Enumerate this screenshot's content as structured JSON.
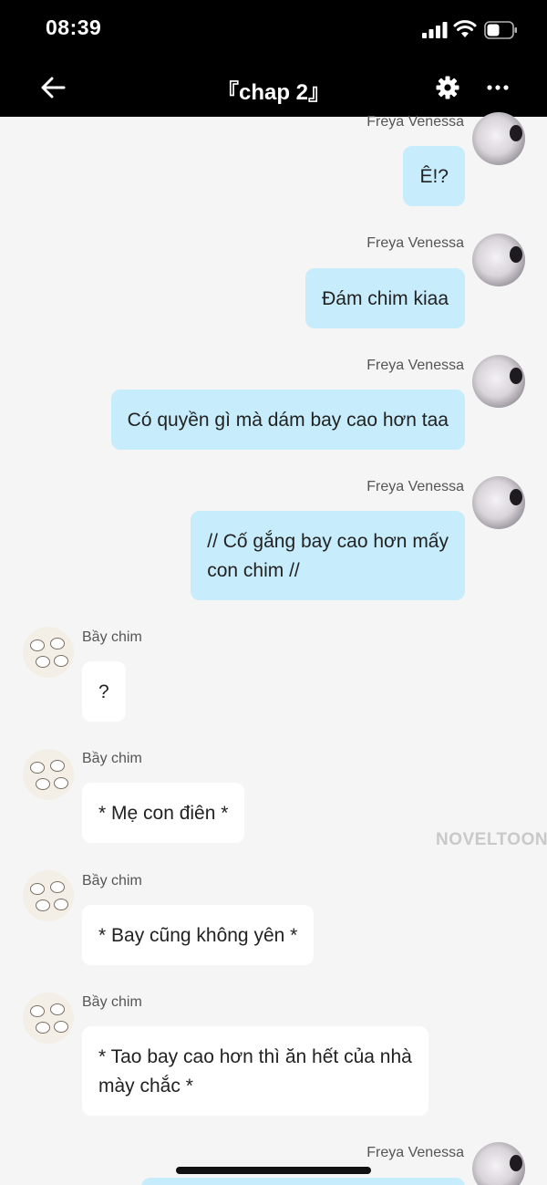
{
  "status": {
    "time": "08:39"
  },
  "header": {
    "title": "『chap 2』"
  },
  "watermark": "NOVELTOON",
  "messages": [
    {
      "sender": "Freya Venessa",
      "text": "Ê!?"
    },
    {
      "sender": "Freya Venessa",
      "text": "Đám chim kiaa"
    },
    {
      "sender": "Freya Venessa",
      "text": "Có quyền gì mà dám bay cao hơn taa"
    },
    {
      "sender": "Freya Venessa",
      "line1": "// Cố gắng bay cao hơn mấy",
      "line2": "con chim //"
    },
    {
      "sender": "Bầy chim",
      "text": "?"
    },
    {
      "sender": "Bầy chim",
      "text": "* Mẹ con điên *"
    },
    {
      "sender": "Bầy chim",
      "text": "* Bay cũng không yên *"
    },
    {
      "sender": "Bầy chim",
      "line1": "* Tao bay cao hơn thì ăn hết của nhà",
      "line2": "mày chắc *"
    },
    {
      "sender": "Freya Venessa"
    }
  ]
}
